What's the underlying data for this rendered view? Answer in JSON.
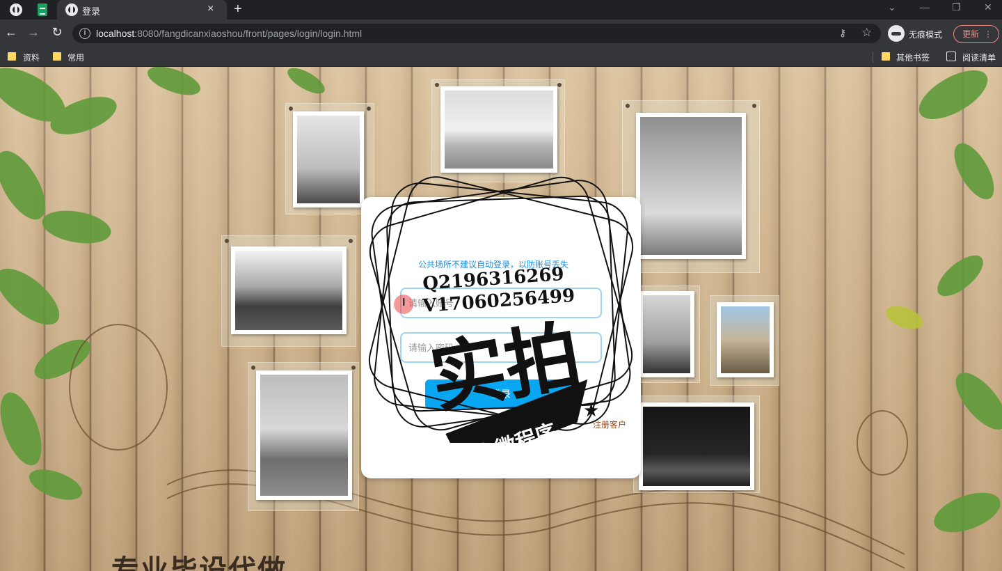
{
  "browser": {
    "tab_title": "登录",
    "tab_close": "×",
    "new_tab": "+",
    "url_host": "localhost",
    "url_path": ":8080/fangdicanxiaoshou/front/pages/login/login.html",
    "incognito_label": "无痕模式",
    "update_label": "更新",
    "bookmarks": [
      "资料",
      "常用"
    ],
    "other_bookmarks": "其他书签",
    "reading_list": "阅读清单"
  },
  "login": {
    "hint": "公共场所不建议自动登录，以防账号丢失",
    "username_placeholder": "请输入账号",
    "password_placeholder": "请输入密码",
    "login_label": "登录",
    "register_label": "注册客户"
  },
  "watermark": {
    "line1": "Q2196316269",
    "line2": "V17060256499",
    "big_text": "实拍",
    "banner": "全微程序"
  },
  "background_text": "专业毕设代做",
  "colors": {
    "accent": "#09a6f2",
    "register_link": "#9b4a1c",
    "hint": "#1e90d8"
  }
}
